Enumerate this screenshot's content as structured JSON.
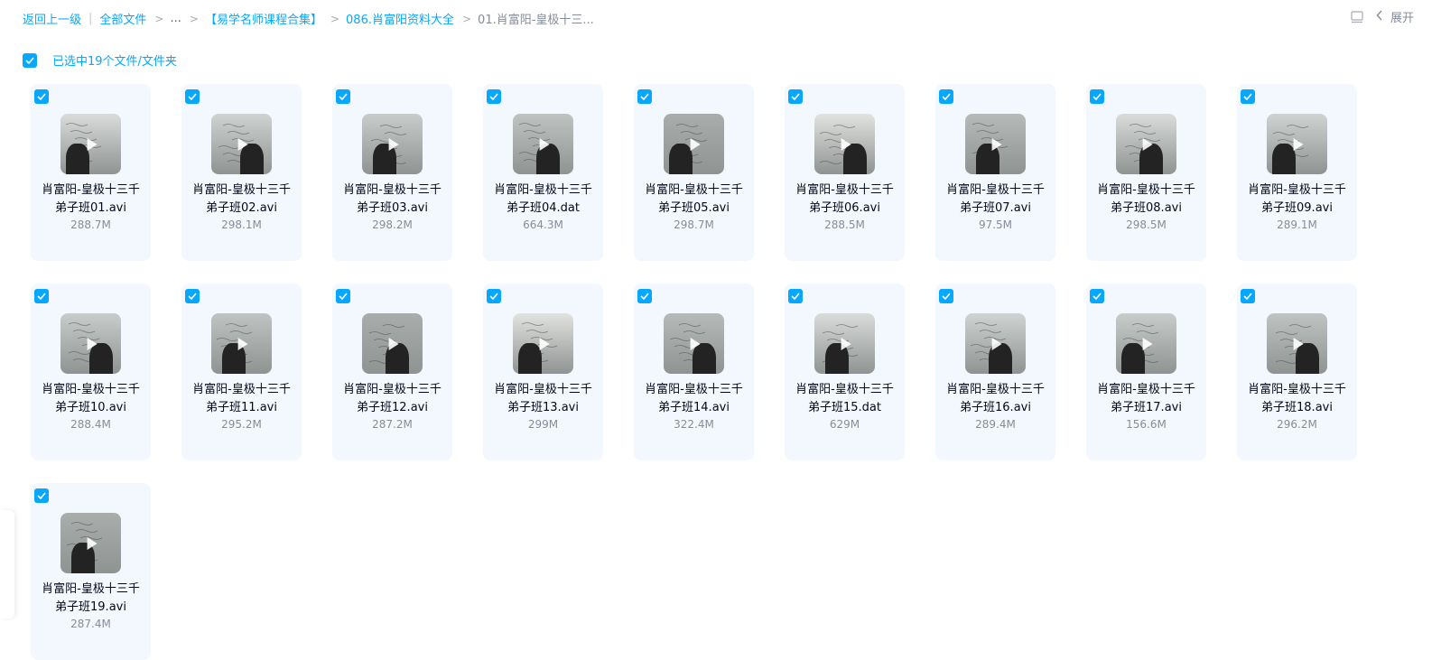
{
  "breadcrumb": {
    "back": "返回上一级",
    "all_files": "全部文件",
    "ellipsis": "...",
    "folder1": "【易学名师课程合集】",
    "folder2": "086.肖富阳资料大全",
    "current": "01.肖富阳-皇极十三..."
  },
  "toolbar": {
    "panel_icon": "panel-layout-icon",
    "expand_label": "展开"
  },
  "selection": {
    "label": "已选中19个文件/文件夹",
    "checked": true
  },
  "files": [
    {
      "line1": "肖富阳-皇极十三千",
      "line2": "弟子班01.avi",
      "size": "288.7M"
    },
    {
      "line1": "肖富阳-皇极十三千",
      "line2": "弟子班02.avi",
      "size": "298.1M"
    },
    {
      "line1": "肖富阳-皇极十三千",
      "line2": "弟子班03.avi",
      "size": "298.2M"
    },
    {
      "line1": "肖富阳-皇极十三千",
      "line2": "弟子班04.dat",
      "size": "664.3M"
    },
    {
      "line1": "肖富阳-皇极十三千",
      "line2": "弟子班05.avi",
      "size": "298.7M"
    },
    {
      "line1": "肖富阳-皇极十三千",
      "line2": "弟子班06.avi",
      "size": "288.5M"
    },
    {
      "line1": "肖富阳-皇极十三千",
      "line2": "弟子班07.avi",
      "size": "97.5M"
    },
    {
      "line1": "肖富阳-皇极十三千",
      "line2": "弟子班08.avi",
      "size": "298.5M"
    },
    {
      "line1": "肖富阳-皇极十三千",
      "line2": "弟子班09.avi",
      "size": "289.1M"
    },
    {
      "line1": "肖富阳-皇极十三千",
      "line2": "弟子班10.avi",
      "size": "288.4M"
    },
    {
      "line1": "肖富阳-皇极十三千",
      "line2": "弟子班11.avi",
      "size": "295.2M"
    },
    {
      "line1": "肖富阳-皇极十三千",
      "line2": "弟子班12.avi",
      "size": "287.2M"
    },
    {
      "line1": "肖富阳-皇极十三千",
      "line2": "弟子班13.avi",
      "size": "299M"
    },
    {
      "line1": "肖富阳-皇极十三千",
      "line2": "弟子班14.avi",
      "size": "322.4M"
    },
    {
      "line1": "肖富阳-皇极十三千",
      "line2": "弟子班15.dat",
      "size": "629M"
    },
    {
      "line1": "肖富阳-皇极十三千",
      "line2": "弟子班16.avi",
      "size": "289.4M"
    },
    {
      "line1": "肖富阳-皇极十三千",
      "line2": "弟子班17.avi",
      "size": "156.6M"
    },
    {
      "line1": "肖富阳-皇极十三千",
      "line2": "弟子班18.avi",
      "size": "296.2M"
    },
    {
      "line1": "肖富阳-皇极十三千",
      "line2": "弟子班19.avi",
      "size": "287.4M"
    }
  ],
  "colors": {
    "accent": "#06a7ff",
    "card_bg": "#f2f8fe",
    "text_primary": "#03081a",
    "text_secondary": "#878c9c"
  }
}
